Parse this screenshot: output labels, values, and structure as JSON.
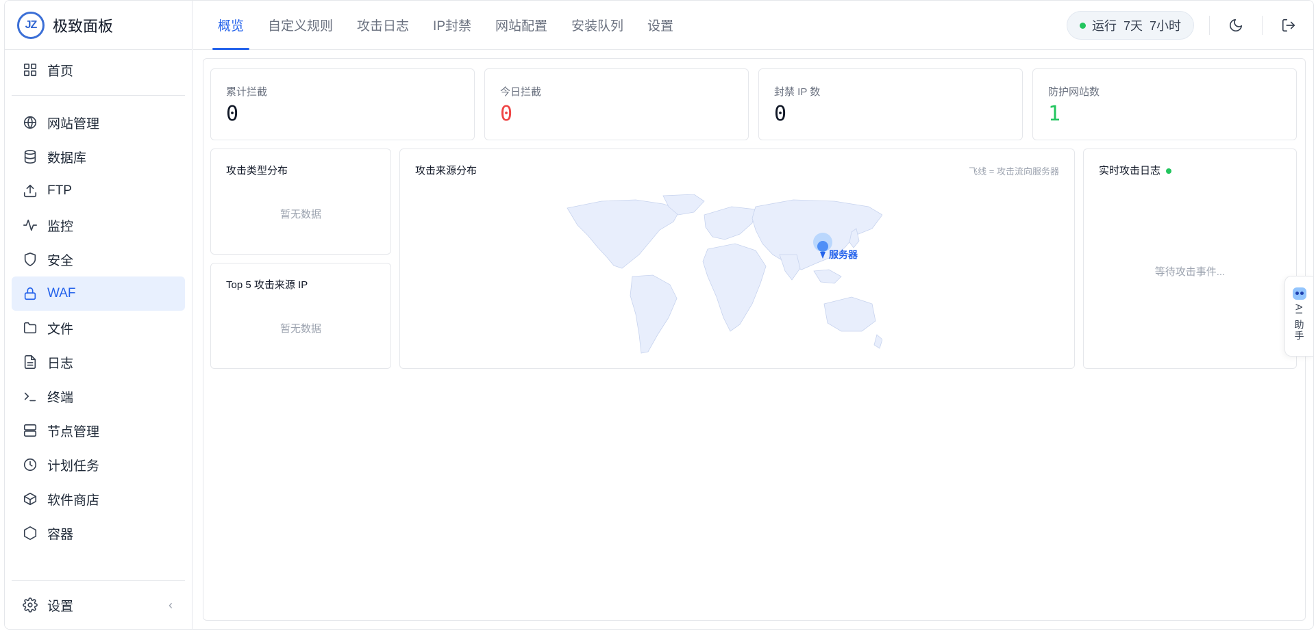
{
  "app": {
    "title": "极致面板",
    "logo_text": "JZ"
  },
  "sidebar": {
    "items": [
      {
        "label": "首页",
        "icon": "grid-icon"
      },
      {
        "label": "网站管理",
        "icon": "globe-icon"
      },
      {
        "label": "数据库",
        "icon": "database-icon"
      },
      {
        "label": "FTP",
        "icon": "upload-icon"
      },
      {
        "label": "监控",
        "icon": "activity-icon"
      },
      {
        "label": "安全",
        "icon": "shield-icon"
      },
      {
        "label": "WAF",
        "icon": "lock-icon",
        "active": true
      },
      {
        "label": "文件",
        "icon": "folder-icon"
      },
      {
        "label": "日志",
        "icon": "file-text-icon"
      },
      {
        "label": "终端",
        "icon": "terminal-icon"
      },
      {
        "label": "节点管理",
        "icon": "server-icon"
      },
      {
        "label": "计划任务",
        "icon": "clock-icon"
      },
      {
        "label": "软件商店",
        "icon": "package-icon"
      },
      {
        "label": "容器",
        "icon": "hexagon-icon"
      }
    ],
    "settings_label": "设置",
    "collapse_glyph": "‹"
  },
  "header": {
    "tabs": [
      "概览",
      "自定义规则",
      "攻击日志",
      "IP封禁",
      "网站配置",
      "安装队列",
      "设置"
    ],
    "active_tab": 0,
    "uptime": "运行  7天  7小时"
  },
  "stats": [
    {
      "label": "累计拦截",
      "value": "0",
      "color": "#111827"
    },
    {
      "label": "今日拦截",
      "value": "0",
      "color": "#ef4444"
    },
    {
      "label": "封禁 IP 数",
      "value": "0",
      "color": "#111827"
    },
    {
      "label": "防护网站数",
      "value": "1",
      "color": "#22c55e"
    }
  ],
  "attack_types": {
    "title": "攻击类型分布",
    "empty": "暂无数据"
  },
  "top_ips": {
    "title": "Top 5 攻击来源 IP",
    "empty": "暂无数据"
  },
  "attack_map": {
    "title": "攻击来源分布",
    "hint": "飞线 = 攻击流向服务器",
    "server_label": "服务器"
  },
  "live_log": {
    "title": "实时攻击日志",
    "empty": "等待攻击事件..."
  },
  "ai_assistant": {
    "label": "AI 助手"
  },
  "colors": {
    "accent": "#2563eb",
    "active_bg": "#e8f0fe",
    "success": "#22c55e",
    "danger": "#ef4444"
  }
}
